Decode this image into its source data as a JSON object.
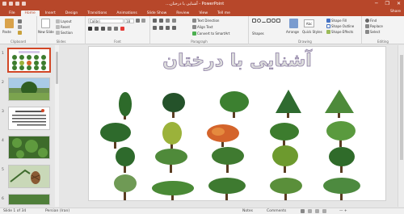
{
  "titlebar": {
    "title": "…آشنایی با درختان - PowerPoint",
    "minimize": "─",
    "restore": "❐",
    "close": "✕"
  },
  "tabs": [
    {
      "label": "File"
    },
    {
      "label": "Home"
    },
    {
      "label": "Insert"
    },
    {
      "label": "Design"
    },
    {
      "label": "Transitions"
    },
    {
      "label": "Animations"
    },
    {
      "label": "Slide Show"
    },
    {
      "label": "Review"
    },
    {
      "label": "View"
    },
    {
      "label": "Tell me"
    }
  ],
  "share_label": "Share",
  "ribbon": {
    "paste": "Paste",
    "clipboard": "Clipboard",
    "new_slide": "New Slide",
    "layout": "Layout",
    "reset": "Reset",
    "section": "Section",
    "slides": "Slides",
    "font_name": "Calibri",
    "font_size": "18",
    "font": "Font",
    "text_direction": "Text Direction",
    "align_text": "Align Text",
    "convert_smartart": "Convert to SmartArt",
    "paragraph": "Paragraph",
    "shapes": "Shapes",
    "arrange": "Arrange",
    "quick_styles": "Quick Styles",
    "shape_fill": "Shape Fill",
    "shape_outline": "Shape Outline",
    "shape_effects": "Shape Effects",
    "drawing": "Drawing",
    "find": "Find",
    "replace": "Replace",
    "select": "Select",
    "editing": "Editing"
  },
  "thumbnails": [
    {
      "num": "1"
    },
    {
      "num": "2"
    },
    {
      "num": "3"
    },
    {
      "num": "4"
    },
    {
      "num": "5"
    },
    {
      "num": "6"
    }
  ],
  "slide": {
    "title": "آشنایی با درختان"
  },
  "statusbar": {
    "slide_info": "Slide 1 of 34",
    "language": "Persian (Iran)",
    "notes": "Notes",
    "comments": "Comments",
    "zoom": "—  +"
  },
  "colors": {
    "accent": "#b7472a",
    "title_outline": "#8c7ea3"
  }
}
